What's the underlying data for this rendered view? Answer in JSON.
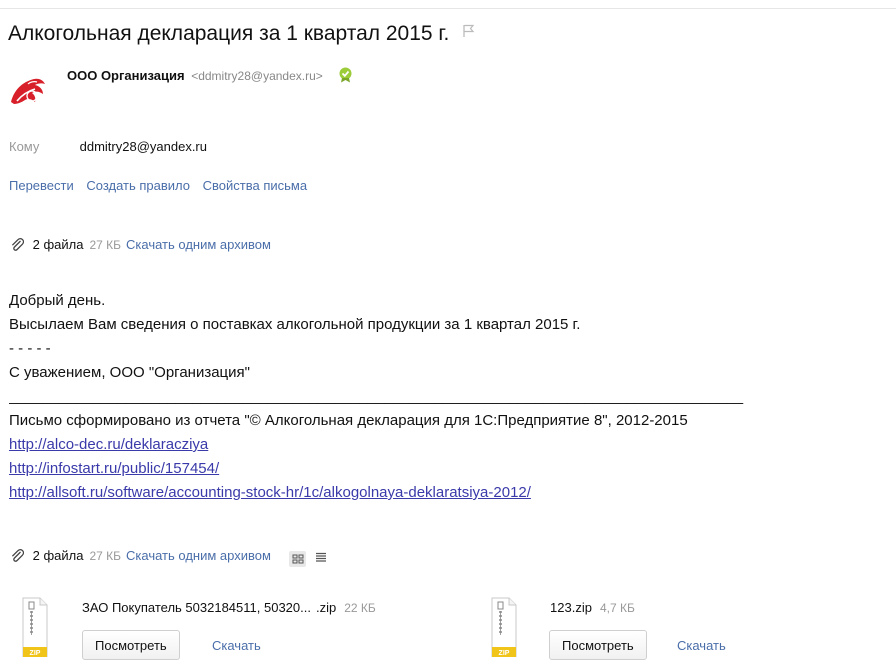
{
  "message": {
    "subject": "Алкогольная декларация за 1 квартал 2015 г.",
    "sender_name": "ООО Организация",
    "sender_email": "<ddmitry28@yandex.ru>",
    "to_label": "Кому",
    "to_value": "ddmitry28@yandex.ru"
  },
  "actions": {
    "translate": "Перевести",
    "create_rule": "Создать правило",
    "properties": "Свойства письма"
  },
  "attachments_summary": {
    "count": "2 файла",
    "size": "27 КБ",
    "download_all": "Скачать одним архивом"
  },
  "body": {
    "greeting": "Добрый день.",
    "line1": "Высылаем Вам сведения о поставках алкогольной продукции за 1 квартал 2015 г.",
    "dashes": "- - - - -",
    "regards": "С уважением, ООО \"Организация\"",
    "separator": "________________________________________________________________________________________",
    "generated": "Письмо сформировано из отчета \"© Алкогольная декларация для 1С:Предприятие 8\", 2012-2015",
    "link1": "http://alco-dec.ru/deklaracziya",
    "link2": "http://infostart.ru/public/157454/",
    "link3": "http://allsoft.ru/software/accounting-stock-hr/1c/alkogolnaya-deklaratsiya-2012/"
  },
  "files": [
    {
      "name": "ЗАО Покупатель 5032184511, 50320...",
      "ext": ".zip",
      "size": "22 КБ",
      "type_label": "ZIP",
      "view": "Посмотреть",
      "download": "Скачать"
    },
    {
      "name": "123",
      "ext": ".zip",
      "size": "4,7 КБ",
      "type_label": "ZIP",
      "view": "Посмотреть",
      "download": "Скачать"
    }
  ],
  "colors": {
    "link": "#4a6ea9",
    "zip_badge": "#f0c419",
    "verified": "#9ccc3a"
  }
}
